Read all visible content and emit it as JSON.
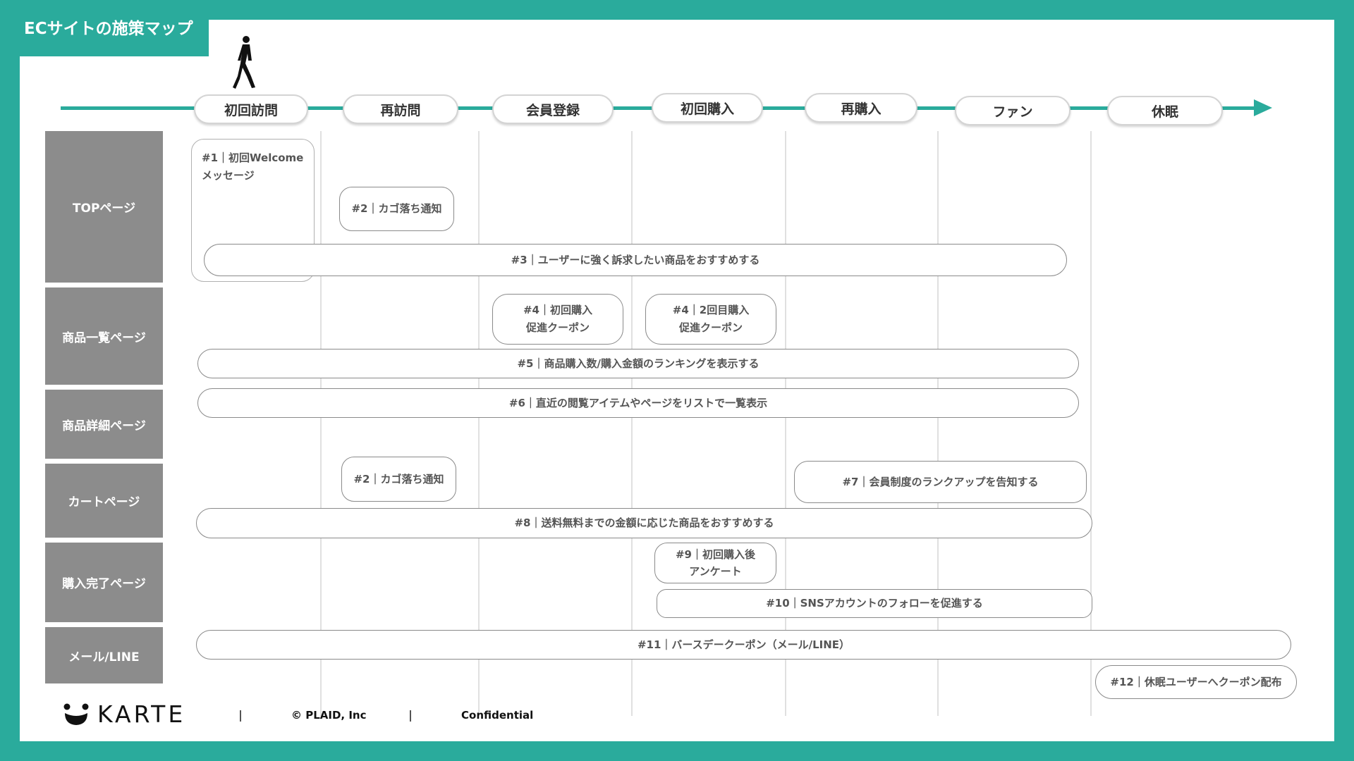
{
  "title": "ECサイトの施策マップ",
  "stages": [
    "初回訪問",
    "再訪問",
    "会員登録",
    "初回購入",
    "再購入",
    "ファン",
    "休眠"
  ],
  "rows": [
    "TOPページ",
    "商品一覧ページ",
    "商品詳細ページ",
    "カートページ",
    "購入完了ページ",
    "メール/LINE"
  ],
  "measures": {
    "m1": "#1｜初回Welcome\nメッセージ",
    "m2a": "#2｜カゴ落ち通知",
    "m3": "#3｜ユーザーに強く訴求したい商品をおすすめする",
    "m4a": "#4｜初回購入\n促進クーポン",
    "m4b": "#4｜2回目購入\n促進クーポン",
    "m5": "#5｜商品購入数/購入金額のランキングを表示する",
    "m6": "#6｜直近の閲覧アイテムやページをリストで一覧表示",
    "m2b": "#2｜カゴ落ち通知",
    "m7": "#7｜会員制度のランクアップを告知する",
    "m8": "#8｜送料無料までの金額に応じた商品をおすすめする",
    "m9": "#9｜初回購入後\nアンケート",
    "m10": "#10｜SNSアカウントのフォローを促進する",
    "m11": "#11｜バースデークーポン（メール/LINE）",
    "m12": "#12｜休眠ユーザーへクーポン配布"
  },
  "footer": {
    "brand": "KARTE",
    "copyright": "© PLAID, Inc",
    "confidential": "Confidential"
  },
  "colors": {
    "accent": "#2aab9c",
    "row_label": "#8c8c8c"
  },
  "icons": [
    "walking-person-icon",
    "karte-logo-icon",
    "arrow-head-icon"
  ]
}
